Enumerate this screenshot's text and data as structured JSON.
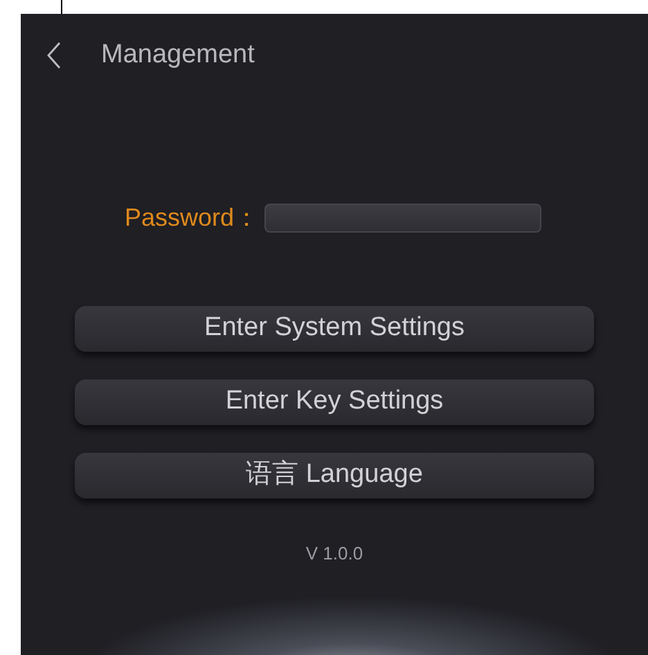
{
  "header": {
    "title": "Management"
  },
  "password": {
    "label": "Password："
  },
  "buttons": [
    "Enter System Settings",
    "Enter Key Settings",
    "语言 Language"
  ],
  "version": "V 1.0.0"
}
